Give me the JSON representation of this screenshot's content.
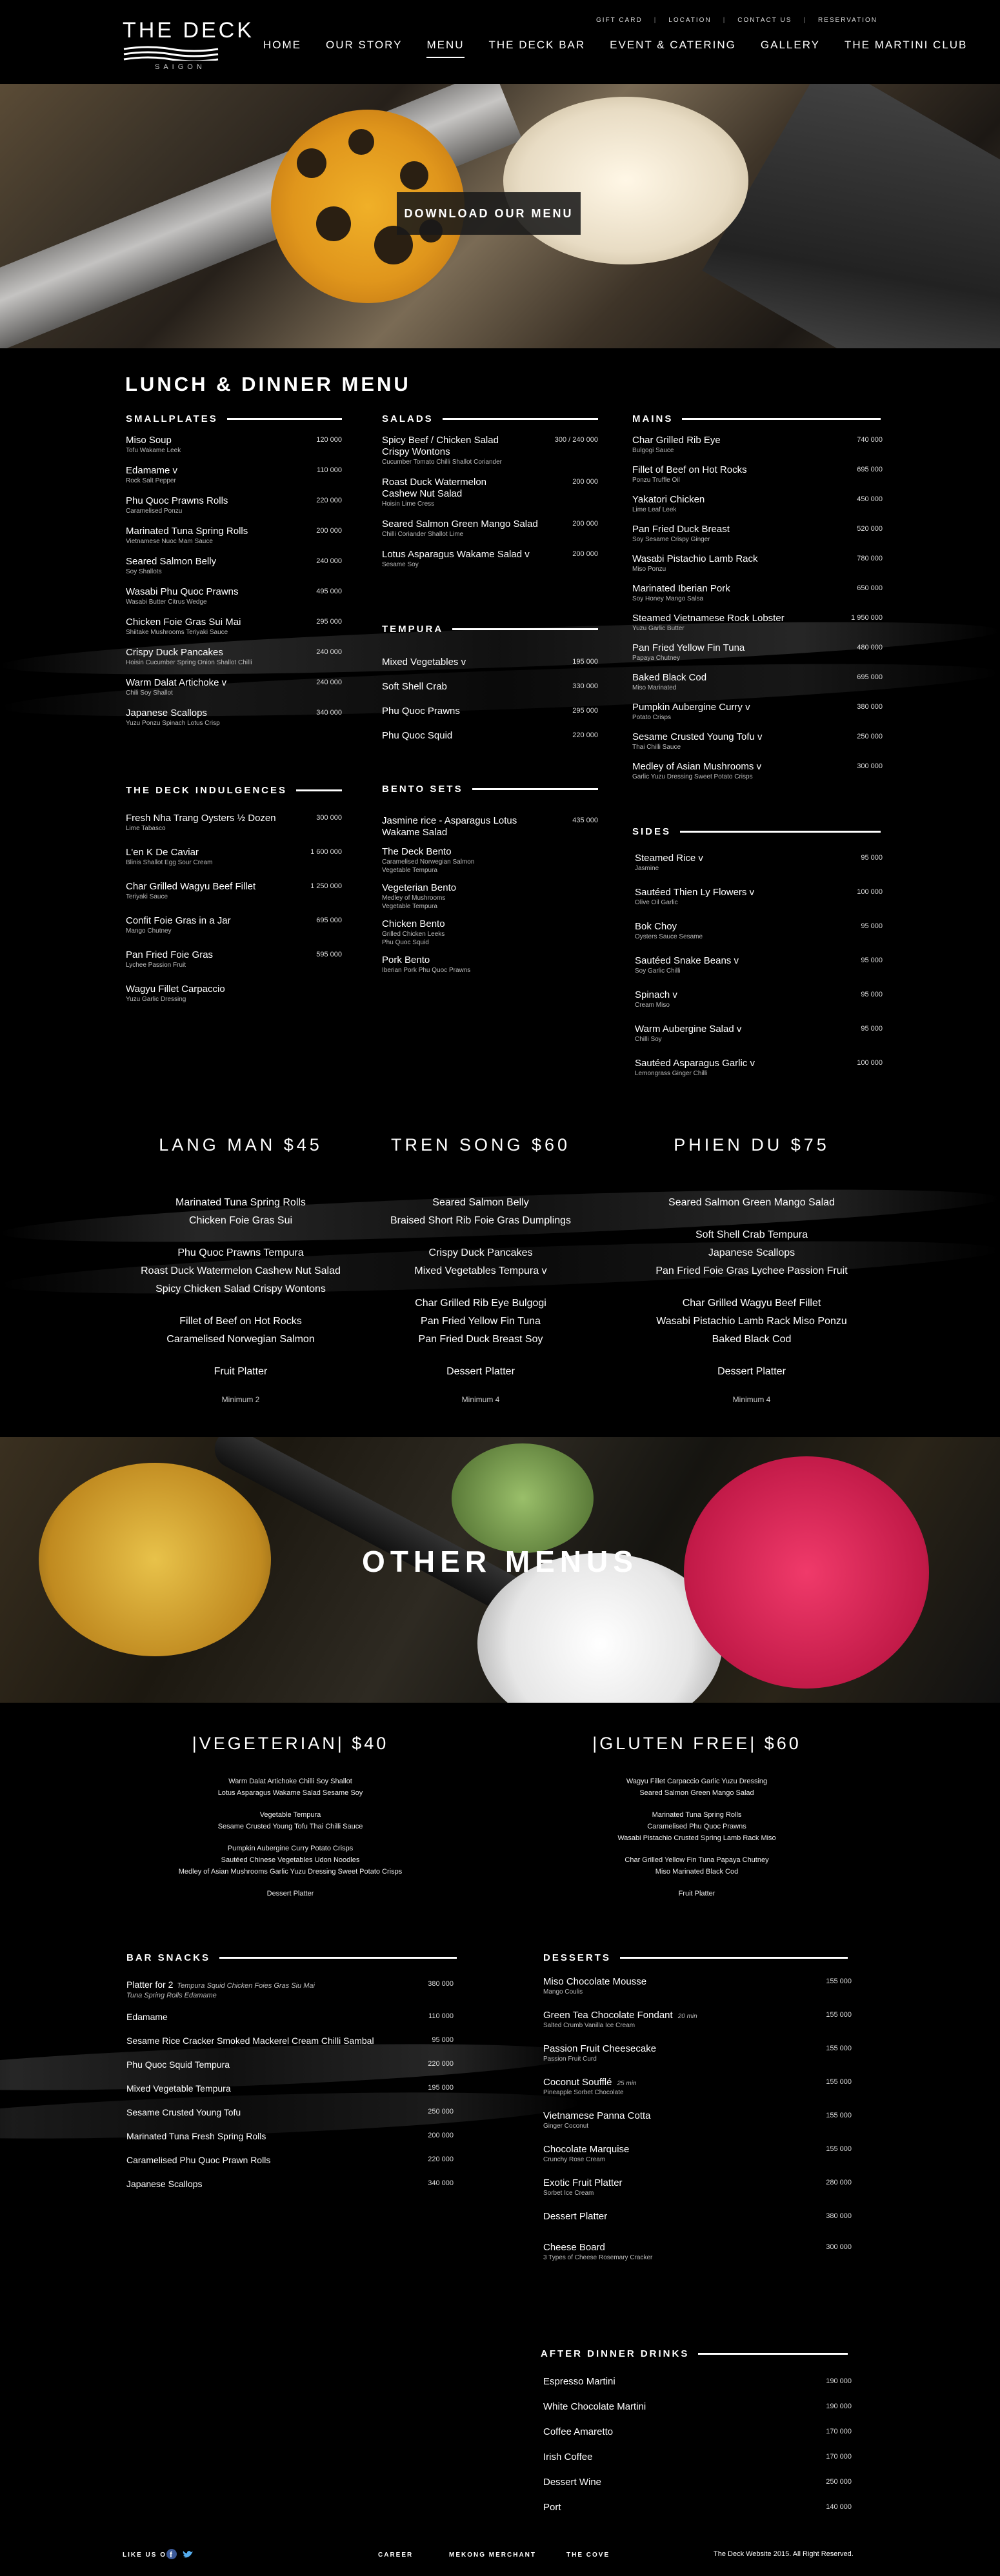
{
  "header": {
    "logo_title": "THE DECK",
    "logo_subtitle": "SAIGON",
    "utility_links": [
      "GIFT CARD",
      "LOCATION",
      "CONTACT US",
      "RESERVATION"
    ],
    "nav": [
      "HOME",
      "OUR STORY",
      "MENU",
      "THE DECK BAR",
      "EVENT & CATERING",
      "GALLERY",
      "THE MARTINI CLUB"
    ],
    "nav_active": "MENU"
  },
  "hero": {
    "download_label": "DOWNLOAD OUR MENU"
  },
  "menu": {
    "title": "LUNCH & DINNER MENU",
    "smallplates": {
      "title": "SMALLPLATES",
      "items": [
        {
          "name": "Miso Soup",
          "desc": "Tofu Wakame Leek",
          "price": "120 000"
        },
        {
          "name": "Edamame  v",
          "desc": "Rock Salt Pepper",
          "price": "110 000"
        },
        {
          "name": "Phu Quoc Prawns Rolls",
          "desc": "Caramelised Ponzu",
          "price": "220 000"
        },
        {
          "name": "Marinated Tuna Spring Rolls",
          "desc": "Vietnamese Nuoc Mam Sauce",
          "price": "200 000"
        },
        {
          "name": "Seared Salmon Belly",
          "desc": "Soy Shallots",
          "price": "240 000"
        },
        {
          "name": "Wasabi Phu Quoc Prawns",
          "desc": "Wasabi Butter Citrus Wedge",
          "price": "495 000"
        },
        {
          "name": "Chicken Foie Gras Sui Mai",
          "desc": "Shiitake Mushrooms Teriyaki Sauce",
          "price": "295 000"
        },
        {
          "name": "Crispy Duck Pancakes",
          "desc": "Hoisin Cucumber Spring Onion Shallot Chilli",
          "price": "240 000"
        },
        {
          "name": "Warm Dalat Artichoke  v",
          "desc": "Chili Soy Shallot",
          "price": "240 000"
        },
        {
          "name": "Japanese Scallops",
          "desc": "Yuzu Ponzu Spinach Lotus Crisp",
          "price": "340 000"
        }
      ]
    },
    "indulgences": {
      "title": "THE DECK INDULGENCES",
      "items": [
        {
          "name": "Fresh Nha Trang Oysters ½ Dozen",
          "desc": "Lime Tabasco",
          "price": "300 000"
        },
        {
          "name": "L'en K De Caviar",
          "desc": "Blinis Shallot Egg Sour Cream",
          "price": "1 600 000"
        },
        {
          "name": "Char Grilled Wagyu Beef Fillet",
          "desc": "Teriyaki Sauce",
          "price": "1 250 000"
        },
        {
          "name": "Confit Foie Gras in a Jar",
          "desc": "Mango Chutney",
          "price": "695 000"
        },
        {
          "name": "Pan Fried Foie Gras",
          "desc": "Lychee Passion Fruit",
          "price": "595 000"
        },
        {
          "name": "Wagyu Fillet Carpaccio",
          "desc": "Yuzu Garlic Dressing",
          "price": ""
        }
      ]
    },
    "salads": {
      "title": "SALADS",
      "items": [
        {
          "name": "Spicy Beef / Chicken Salad",
          "name2": "Crispy Wontons",
          "desc": "Cucumber Tomato Chilli Shallot Coriander",
          "price": "300 / 240 000"
        },
        {
          "name": "Roast Duck Watermelon",
          "name2": "Cashew Nut Salad",
          "desc": "Hoisin Lime Cress",
          "price": "200 000"
        },
        {
          "name": "Seared Salmon Green Mango Salad",
          "name2": "",
          "desc": "Chilli Coriander Shallot Lime",
          "price": "200 000"
        },
        {
          "name": "Lotus Asparagus Wakame Salad  v",
          "name2": "",
          "desc": "Sesame Soy",
          "price": "200 000"
        }
      ]
    },
    "tempura": {
      "title": "TEMPURA",
      "items": [
        {
          "name": "Mixed Vegetables  v",
          "price": "195 000"
        },
        {
          "name": "Soft Shell Crab",
          "price": "330 000"
        },
        {
          "name": "Phu Quoc Prawns",
          "price": "295 000"
        },
        {
          "name": "Phu Quoc Squid",
          "price": "220 000"
        }
      ]
    },
    "bento": {
      "title": "BENTO SETS",
      "items": [
        {
          "name": "Jasmine rice  -  Asparagus Lotus",
          "name2": "Wakame Salad",
          "desc": "",
          "desc2": "",
          "price": "435 000"
        },
        {
          "name": "The Deck Bento",
          "name2": "",
          "desc": "Caramelised Norwegian Salmon",
          "desc2": "Vegetable Tempura",
          "price": ""
        },
        {
          "name": "Vegeterian Bento",
          "name2": "",
          "desc": "Medley of Mushrooms",
          "desc2": "Vegetable Tempura",
          "price": ""
        },
        {
          "name": "Chicken Bento",
          "name2": "",
          "desc": "Grilled Chicken Leeks",
          "desc2": "Phu Quoc Squid",
          "price": ""
        },
        {
          "name": "Pork Bento",
          "name2": "",
          "desc": "Iberian Pork Phu Quoc Prawns",
          "desc2": "",
          "price": ""
        }
      ]
    },
    "mains": {
      "title": "MAINS",
      "items": [
        {
          "name": "Char Grilled Rib Eye",
          "desc": "Bulgogi Sauce",
          "price": "740 000"
        },
        {
          "name": "Fillet of Beef on Hot Rocks",
          "desc": "Ponzu Truffle Oil",
          "price": "695 000"
        },
        {
          "name": "Yakatori Chicken",
          "desc": "Lime Leaf Leek",
          "price": "450 000"
        },
        {
          "name": "Pan Fried Duck Breast",
          "desc": "Soy Sesame Crispy Ginger",
          "price": "520 000"
        },
        {
          "name": "Wasabi Pistachio Lamb Rack",
          "desc": "Miso Ponzu",
          "price": "780 000"
        },
        {
          "name": "Marinated Iberian Pork",
          "desc": "Soy Honey Mango Salsa",
          "price": "650 000"
        },
        {
          "name": "Steamed Vietnamese Rock Lobster",
          "desc": "Yuzu Garlic Butter",
          "price": "1 950 000"
        },
        {
          "name": "Pan Fried Yellow Fin Tuna",
          "desc": "Papaya Chutney",
          "price": "480 000"
        },
        {
          "name": "Baked Black Cod",
          "desc": "Miso Marinated",
          "price": "695 000"
        },
        {
          "name": "Pumpkin Aubergine Curry  v",
          "desc": "Potato Crisps",
          "price": "380 000"
        },
        {
          "name": "Sesame Crusted Young Tofu  v",
          "desc": "Thai Chilli Sauce",
          "price": "250 000"
        },
        {
          "name": "Medley of Asian Mushrooms  v",
          "desc": "Garlic Yuzu Dressing Sweet Potato Crisps",
          "price": "300 000"
        }
      ]
    },
    "sides": {
      "title": "SIDES",
      "items": [
        {
          "name": "Steamed Rice  v",
          "desc": "Jasmine",
          "price": "95 000"
        },
        {
          "name": "Sautéed Thien Ly Flowers  v",
          "desc": "Olive Oil Garlic",
          "price": "100 000"
        },
        {
          "name": "Bok Choy",
          "desc": "Oysters Sauce Sesame",
          "price": "95 000"
        },
        {
          "name": "Sautéed Snake Beans  v",
          "desc": "Soy Garlic Chilli",
          "price": "95 000"
        },
        {
          "name": "Spinach  v",
          "desc": "Cream Miso",
          "price": "95 000"
        },
        {
          "name": "Warm Aubergine Salad  v",
          "desc": "Chilli Soy",
          "price": "95 000"
        },
        {
          "name": "Sautéed Asparagus Garlic  v",
          "desc": "Lemongrass Ginger Chilli",
          "price": "100 000"
        }
      ]
    }
  },
  "set_menus": [
    {
      "title": "LANG MAN $45",
      "groups": [
        [
          "Marinated Tuna Spring Rolls",
          "Chicken Foie Gras Sui"
        ],
        [
          "Phu Quoc Prawns Tempura",
          "Roast Duck Watermelon Cashew Nut Salad",
          "Spicy Chicken Salad Crispy Wontons"
        ],
        [
          "Fillet of Beef on Hot Rocks",
          "Caramelised Norwegian Salmon"
        ],
        [
          "Fruit Platter"
        ]
      ],
      "minimum": "Minimum 2"
    },
    {
      "title": "TREN SONG $60",
      "groups": [
        [
          "Seared Salmon Belly",
          "Braised Short Rib Foie Gras Dumplings"
        ],
        [
          "Crispy Duck Pancakes",
          "Mixed Vegetables Tempura  v"
        ],
        [
          "Char Grilled Rib Eye Bulgogi",
          "Pan Fried Yellow Fin Tuna",
          "Pan Fried Duck Breast Soy"
        ],
        [
          "Dessert Platter"
        ]
      ],
      "minimum": "Minimum 4"
    },
    {
      "title": "PHIEN DU $75",
      "groups": [
        [
          "Seared Salmon Green Mango Salad"
        ],
        [
          "Soft Shell Crab Tempura",
          "Japanese Scallops",
          "Pan Fried Foie Gras Lychee Passion Fruit"
        ],
        [
          "Char Grilled Wagyu Beef Fillet",
          "Wasabi Pistachio Lamb Rack Miso Ponzu",
          "Baked Black Cod"
        ],
        [
          "Dessert Platter"
        ]
      ],
      "minimum": "Minimum 4"
    }
  ],
  "other_menus": {
    "title": "OTHER MENUS",
    "vegetarian": {
      "title": "|VEGETERIAN| $40",
      "groups": [
        [
          "Warm Dalat Artichoke Chilli Soy Shallot",
          "Lotus Asparagus Wakame Salad Sesame Soy"
        ],
        [
          "Vegetable Tempura",
          "Sesame Crusted Young Tofu Thai Chilli Sauce"
        ],
        [
          "Pumpkin Aubergine Curry Potato Crisps",
          "Sautéed Chinese Vegetables Udon Noodles",
          "Medley of Asian Mushrooms Garlic Yuzu Dressing Sweet Potato Crisps"
        ],
        [
          "Dessert Platter"
        ]
      ]
    },
    "gluten_free": {
      "title": "|GLUTEN FREE| $60",
      "groups": [
        [
          "Wagyu Fillet Carpaccio Garlic Yuzu Dressing",
          "Seared Salmon Green Mango Salad"
        ],
        [
          "Marinated Tuna Spring Rolls",
          "Caramelised Phu Quoc Prawns",
          "Wasabi Pistachio Crusted Spring Lamb Rack Miso"
        ],
        [
          "Char Grilled Yellow Fin Tuna Papaya Chutney",
          "Miso Marinated Black Cod"
        ],
        [
          "Fruit Platter"
        ]
      ]
    },
    "bar_snacks": {
      "title": "BAR SNACKS",
      "items": [
        {
          "name": "Platter for 2",
          "desc": "Tempura Squid Chicken Foies Gras Siu Mai",
          "desc2": "Tuna Spring Rolls Edamame",
          "price": "380 000"
        },
        {
          "name": "Edamame",
          "desc": "",
          "desc2": "",
          "price": "110 000"
        },
        {
          "name": "Sesame Rice Cracker Smoked Mackerel Cream Chilli Sambal",
          "desc": "",
          "desc2": "",
          "price": "95 000"
        },
        {
          "name": "Phu Quoc Squid Tempura",
          "desc": "",
          "desc2": "",
          "price": "220 000"
        },
        {
          "name": "Mixed Vegetable Tempura",
          "desc": "",
          "desc2": "",
          "price": "195 000"
        },
        {
          "name": "Sesame Crusted Young Tofu",
          "desc": "",
          "desc2": "",
          "price": "250 000"
        },
        {
          "name": "Marinated Tuna Fresh Spring Rolls",
          "desc": "",
          "desc2": "",
          "price": "200 000"
        },
        {
          "name": "Caramelised Phu Quoc Prawn Rolls",
          "desc": "",
          "desc2": "",
          "price": "220 000"
        },
        {
          "name": "Japanese Scallops",
          "desc": "",
          "desc2": "",
          "price": "340 000"
        }
      ]
    },
    "desserts": {
      "title": "DESSERTS",
      "items": [
        {
          "name": "Miso Chocolate Mousse",
          "note": "",
          "desc": "Mango Coulis",
          "price": "155 000"
        },
        {
          "name": "Green Tea Chocolate Fondant",
          "note": "20 min",
          "desc": "Salted Crumb Vanilla Ice Cream",
          "price": "155 000"
        },
        {
          "name": "Passion Fruit Cheesecake",
          "note": "",
          "desc": "Passion Fruit Curd",
          "price": "155 000"
        },
        {
          "name": "Coconut Soufflé",
          "note": "25 min",
          "desc": "Pineapple Sorbet Chocolate",
          "price": "155 000"
        },
        {
          "name": "Vietnamese Panna Cotta",
          "note": "",
          "desc": "Ginger Coconut",
          "price": "155 000"
        },
        {
          "name": "Chocolate Marquise",
          "note": "",
          "desc": "Crunchy Rose Cream",
          "price": "155 000"
        },
        {
          "name": "Exotic Fruit Platter",
          "note": "",
          "desc": "Sorbet Ice Cream",
          "price": "280 000"
        },
        {
          "name": "Dessert Platter",
          "note": "",
          "desc": "",
          "price": "380 000"
        },
        {
          "name": "Cheese Board",
          "note": "",
          "desc": "3 Types of Cheese Rosemary Cracker",
          "price": "300 000"
        }
      ]
    },
    "after_dinner": {
      "title": "AFTER DINNER DRINKS",
      "items": [
        {
          "name": "Espresso Martini",
          "price": "190 000"
        },
        {
          "name": "White Chocolate Martini",
          "price": "190 000"
        },
        {
          "name": "Coffee Amaretto",
          "price": "170 000"
        },
        {
          "name": "Irish Coffee",
          "price": "170 000"
        },
        {
          "name": "Dessert Wine",
          "price": "250 000"
        },
        {
          "name": "Port",
          "price": "140 000"
        }
      ]
    }
  },
  "footer": {
    "like_us": "LIKE US ON",
    "links": [
      "CAREER",
      "MEKONG MERCHANT",
      "THE COVE"
    ],
    "copyright": "The Deck Website 2015. All Right Reserved."
  }
}
